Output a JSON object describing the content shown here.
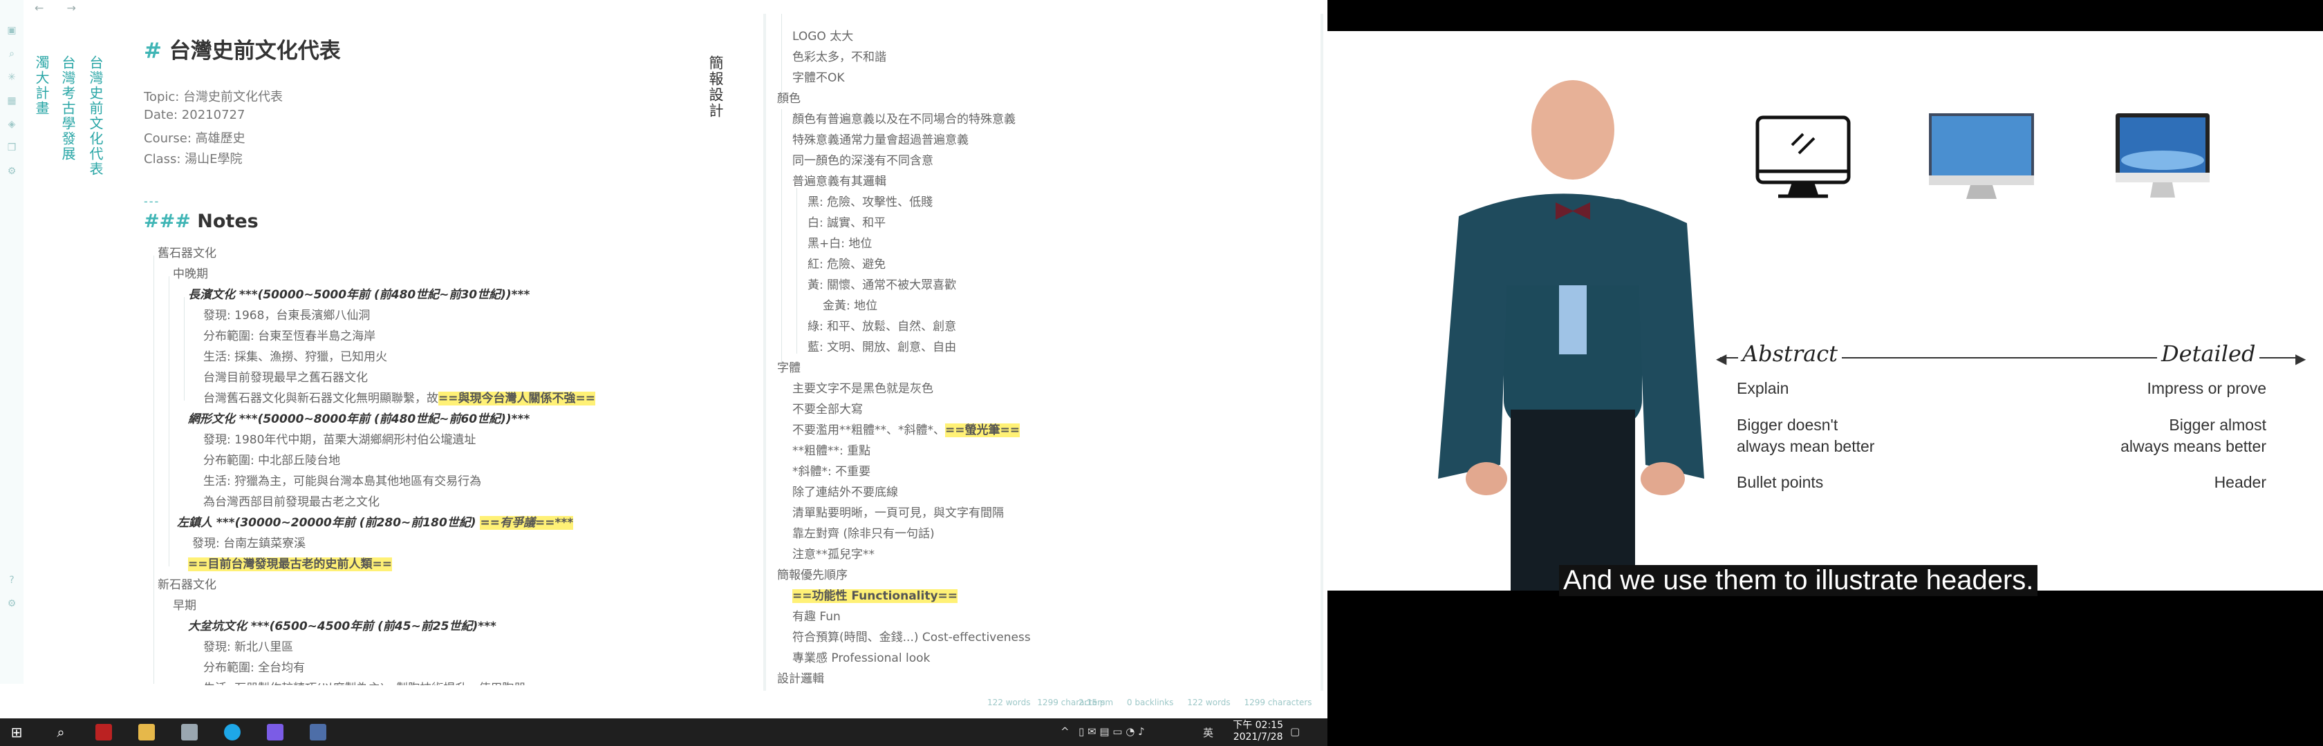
{
  "editor": {
    "nav": {
      "back": "←",
      "forward": "→"
    },
    "vertical_tabs": [
      "濁大計畫",
      "台灣考古學發展",
      "台灣史前文化代表"
    ],
    "doc_title": "台灣史前文化代表",
    "meta": [
      "Topic: 台灣史前文化代表",
      "Date: 20210727",
      "Course: 高雄歷史",
      "Class: 湯山E學院"
    ],
    "hr": "---",
    "notes_heading": "Notes",
    "lines": [
      "舊石器文化",
      "中晚期",
      "長濱文化 ***(50000~5000年前 (前480世紀~前30世紀))***",
      "發現: 1968，台東長濱鄉八仙洞",
      "分布範圍: 台東至恆春半島之海岸",
      "生活: 採集、漁撈、狩獵，已知用火",
      "台灣目前發現最早之舊石器文化",
      "台灣舊石器文化與新石器文化無明顯聯繫，故",
      "==與現今台灣人關係不強==",
      "網形文化 ***(50000~8000年前 (前480世紀~前60世紀))***",
      "發現: 1980年代中期，苗栗大湖鄉網形村伯公壠遺址",
      "分布範圍: 中北部丘陵台地",
      "生活: 狩獵為主，可能與台灣本島其他地區有交易行為",
      "為台灣西部目前發現最古老之文化",
      "左鎮人 ***(30000~20000年前 (前280~前180世紀)",
      "==有爭議==***",
      "發現: 台南左鎮菜寮溪",
      "==目前台灣發現最古老的史前人類==",
      "新石器文化",
      "早期",
      "大坌坑文化 ***(6500~4500年前 (前45~前25世紀)***",
      "發現: 新北八里區",
      "分布範圍: 全台均有",
      "生活: 石器製作較精巧(以磨製為主)，製陶技術提升，使用陶器"
    ],
    "vertical_title": "簡報設計",
    "right_lines": [
      "LOGO 太大",
      "色彩太多，不和諧",
      "字體不OK",
      "顏色",
      "顏色有普遍意義以及在不同場合的特殊意義",
      "特殊意義通常力量會超過普遍意義",
      "同一顏色的深淺有不同含意",
      "普遍意義有其邏輯",
      "黑: 危險、攻擊性、低賤",
      "白: 誠實、和平",
      "黑+白: 地位",
      "紅: 危險、避免",
      "黃: 關懷、通常不被大眾喜歡",
      "金黃: 地位",
      "綠: 和平、放鬆、自然、創意",
      "藍: 文明、開放、創意、自由",
      "字體",
      "主要文字不是黑色就是灰色",
      "不要全部大寫",
      "不要濫用**粗體**、*斜體*、",
      "==螢光筆==",
      "**粗體**: 重點",
      "*斜體*: 不重要",
      "除了連結外不要底線",
      "清單點要明晰，一頁可見，與文字有間隔",
      "靠左對齊 (除非只有一句話)",
      "注意**孤兒字**",
      "簡報優先順序",
      "==功能性 Functionality==",
      "有趣 Fun",
      "符合預算(時間、金錢...) Cost-effectiveness",
      "專業感 Professional look",
      "設計邏輯"
    ],
    "status_left": [
      "122 words",
      "1299 characters"
    ],
    "status_right": [
      "2:15 pm",
      "0 backlinks",
      "122 words",
      "1299 characters"
    ]
  },
  "taskbar": {
    "tray_icons": [
      "^",
      "英"
    ],
    "time": "下午 02:15",
    "date": "2021/7/28"
  },
  "video": {
    "axis_left": "Abstract",
    "axis_right": "Detailed",
    "left_items": [
      "Explain",
      "Bigger doesn't\nalways mean better",
      "Bullet points"
    ],
    "right_items": [
      "Impress or prove",
      "Bigger almost\nalways means better",
      "Header"
    ],
    "caption": "And we use them to illustrate headers."
  }
}
